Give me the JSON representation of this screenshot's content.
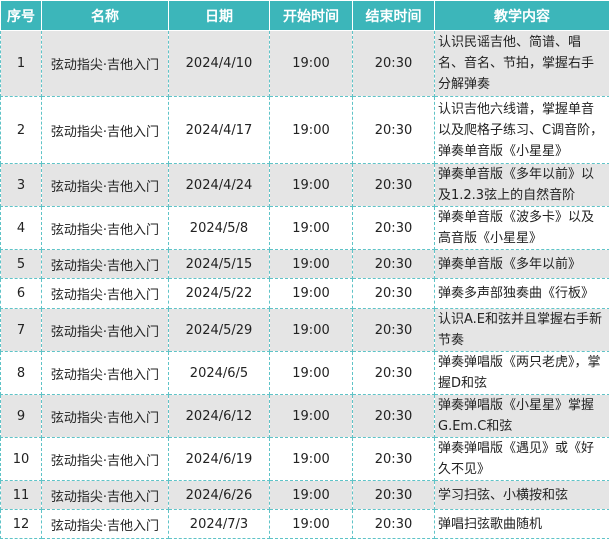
{
  "headers": {
    "no": "序号",
    "name": "名称",
    "date": "日期",
    "start": "开始时间",
    "end": "结束时间",
    "content": "教学内容"
  },
  "colors": {
    "header_bg": "#3cb6ba",
    "header_text": "#ffffff",
    "row_alt": "#e5e5e5",
    "border": "#5fc3c7"
  },
  "rows": [
    {
      "no": "1",
      "name": "弦动指尖·吉他入门",
      "date": "2024/4/10",
      "start": "19:00",
      "end": "20:30",
      "content": "认识民谣吉他、简谱、唱名、音名、节拍，掌握右手分解弹奏"
    },
    {
      "no": "2",
      "name": "弦动指尖·吉他入门",
      "date": "2024/4/17",
      "start": "19:00",
      "end": "20:30",
      "content": "认识吉他六线谱，掌握单音以及爬格子练习、C调音阶，弹奏单音版《小星星》"
    },
    {
      "no": "3",
      "name": "弦动指尖·吉他入门",
      "date": "2024/4/24",
      "start": "19:00",
      "end": "20:30",
      "content": "弹奏单音版《多年以前》以及1.2.3弦上的自然音阶"
    },
    {
      "no": "4",
      "name": "弦动指尖·吉他入门",
      "date": "2024/5/8",
      "start": "19:00",
      "end": "20:30",
      "content": "弹奏单音版《波多卡》以及高音版《小星星》"
    },
    {
      "no": "5",
      "name": "弦动指尖·吉他入门",
      "date": "2024/5/15",
      "start": "19:00",
      "end": "20:30",
      "content": "弹奏单音版《多年以前》"
    },
    {
      "no": "6",
      "name": "弦动指尖·吉他入门",
      "date": "2024/5/22",
      "start": "19:00",
      "end": "20:30",
      "content": "弹奏多声部独奏曲《行板》"
    },
    {
      "no": "7",
      "name": "弦动指尖·吉他入门",
      "date": "2024/5/29",
      "start": "19:00",
      "end": "20:30",
      "content": "认识A.E和弦并且掌握右手新节奏"
    },
    {
      "no": "8",
      "name": "弦动指尖·吉他入门",
      "date": "2024/6/5",
      "start": "19:00",
      "end": "20:30",
      "content": "弹奏弹唱版《两只老虎》，掌握D和弦"
    },
    {
      "no": "9",
      "name": "弦动指尖·吉他入门",
      "date": "2024/6/12",
      "start": "19:00",
      "end": "20:30",
      "content": "弹奏弹唱版《小星星》掌握G.Em.C和弦"
    },
    {
      "no": "10",
      "name": "弦动指尖·吉他入门",
      "date": "2024/6/19",
      "start": "19:00",
      "end": "20:30",
      "content": "弹奏弹唱版《遇见》或《好久不见》"
    },
    {
      "no": "11",
      "name": "弦动指尖·吉他入门",
      "date": "2024/6/26",
      "start": "19:00",
      "end": "20:30",
      "content": "学习扫弦、小横按和弦"
    },
    {
      "no": "12",
      "name": "弦动指尖·吉他入门",
      "date": "2024/7/3",
      "start": "19:00",
      "end": "20:30",
      "content": "弹唱扫弦歌曲随机"
    }
  ]
}
